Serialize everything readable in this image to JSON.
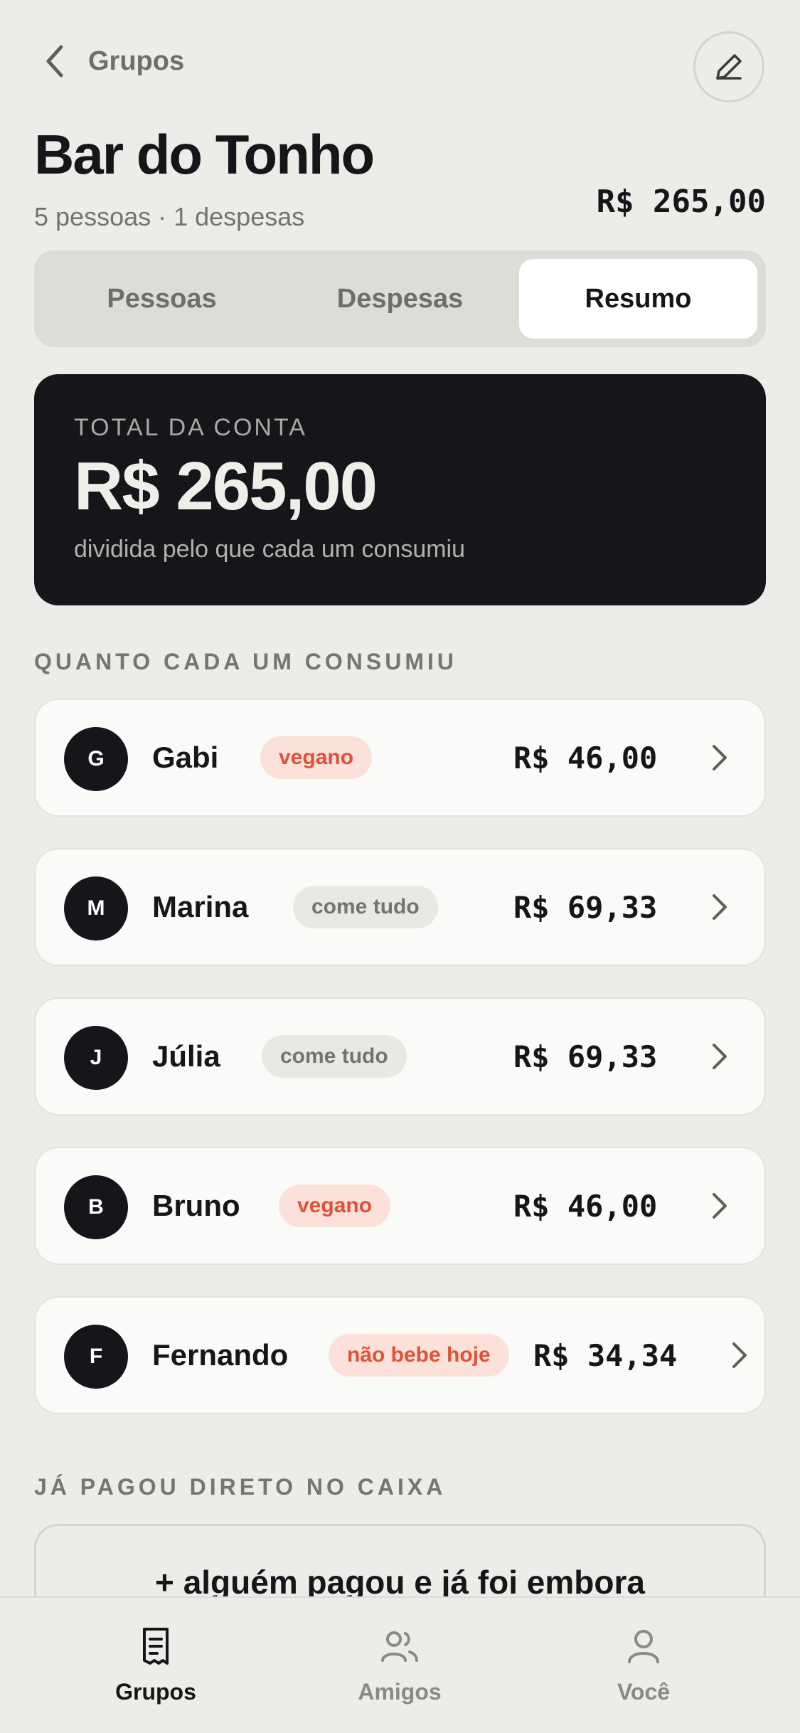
{
  "header": {
    "back_label": "Grupos",
    "title": "Bar do Tonho",
    "subtitle": "5 pessoas · 1 despesas",
    "total": "R$ 265,00"
  },
  "tabs": [
    {
      "label": "Pessoas",
      "active": false
    },
    {
      "label": "Despesas",
      "active": false
    },
    {
      "label": "Resumo",
      "active": true
    }
  ],
  "total_card": {
    "label": "TOTAL DA CONTA",
    "value": "R$ 265,00",
    "note": "dividida pelo que cada um consumiu"
  },
  "consumption": {
    "section_title": "QUANTO CADA UM CONSUMIU",
    "people": [
      {
        "initial": "G",
        "name": "Gabi",
        "badge": "vegano",
        "badge_type": "vegan",
        "amount": "R$ 46,00"
      },
      {
        "initial": "M",
        "name": "Marina",
        "badge": "come tudo",
        "badge_type": "all",
        "amount": "R$ 69,33"
      },
      {
        "initial": "J",
        "name": "Júlia",
        "badge": "come tudo",
        "badge_type": "all",
        "amount": "R$ 69,33"
      },
      {
        "initial": "B",
        "name": "Bruno",
        "badge": "vegano",
        "badge_type": "vegan",
        "amount": "R$ 46,00"
      },
      {
        "initial": "F",
        "name": "Fernando",
        "badge": "não bebe hoje",
        "badge_type": "vegan",
        "amount": "R$ 34,34"
      }
    ]
  },
  "paid": {
    "section_title": "JÁ PAGOU DIRETO NO CAIXA",
    "add_label": "+ alguém pagou e já foi embora"
  },
  "nav": [
    {
      "label": "Grupos",
      "icon": "receipt-icon",
      "active": true
    },
    {
      "label": "Amigos",
      "icon": "friends-icon",
      "active": false
    },
    {
      "label": "Você",
      "icon": "user-icon",
      "active": false
    }
  ],
  "colors": {
    "background": "#ECECE8",
    "dark": "#16161A",
    "vegan_badge_bg": "#FBE1D9",
    "vegan_badge_text": "#E0513A"
  }
}
